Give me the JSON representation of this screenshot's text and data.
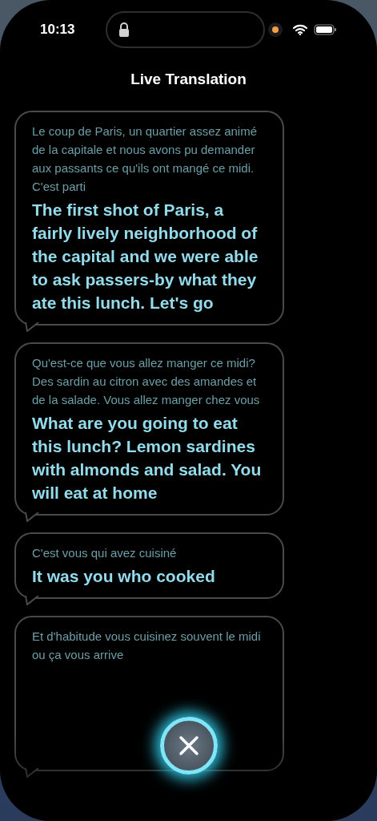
{
  "status_bar": {
    "time": "10:13"
  },
  "title": "Live Translation",
  "messages": [
    {
      "source": "Le coup de Paris, un quartier assez animé de la capitale et nous avons pu demander aux passants ce qu'ils ont mangé ce midi. C'est parti",
      "translation": "The first shot of Paris, a fairly lively neighborhood of the capital and we were able to ask passers-by what they ate this lunch. Let's go"
    },
    {
      "source": "Qu'est-ce que vous allez manger ce midi? Des sardin au citron avec des amandes et de la salade. Vous allez manger chez vous",
      "translation": "What are you going to eat this lunch? Lemon sardines with almonds and salad. You will eat at home"
    },
    {
      "source": "C'est vous qui avez cuisiné",
      "translation": "It was you who cooked"
    },
    {
      "source": "Et d'habitude vous cuisinez souvent le midi ou ça vous arrive"
    }
  ]
}
